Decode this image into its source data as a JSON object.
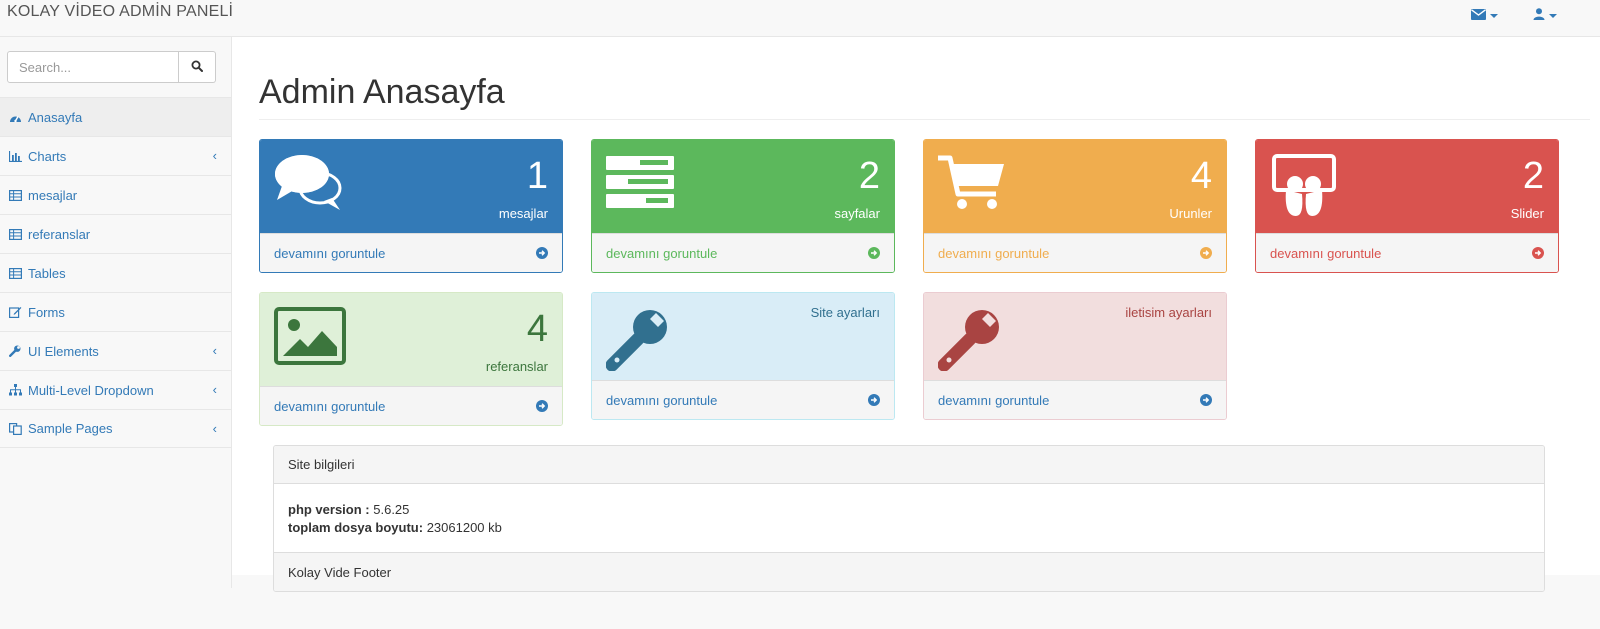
{
  "navbar": {
    "brand": "KOLAY VİDEO ADMİN PANELİ",
    "icons": [
      "envelope-icon",
      "user-icon"
    ]
  },
  "sidebar": {
    "search_placeholder": "Search...",
    "items": [
      {
        "label": "Anasayfa",
        "icon": "dashboard-icon",
        "has_submenu": false,
        "active": true
      },
      {
        "label": "Charts",
        "icon": "bar-chart-icon",
        "has_submenu": true,
        "active": false
      },
      {
        "label": "mesajlar",
        "icon": "table-icon",
        "has_submenu": false,
        "active": false
      },
      {
        "label": "referanslar",
        "icon": "table-icon",
        "has_submenu": false,
        "active": false
      },
      {
        "label": "Tables",
        "icon": "table-icon",
        "has_submenu": false,
        "active": false
      },
      {
        "label": "Forms",
        "icon": "edit-icon",
        "has_submenu": false,
        "active": false
      },
      {
        "label": "UI Elements",
        "icon": "wrench-icon",
        "has_submenu": true,
        "active": false
      },
      {
        "label": "Multi-Level Dropdown",
        "icon": "sitemap-icon",
        "has_submenu": true,
        "active": false
      },
      {
        "label": "Sample Pages",
        "icon": "files-icon",
        "has_submenu": true,
        "active": false
      }
    ]
  },
  "main": {
    "title": "Admin Anasayfa",
    "cards": [
      {
        "count": "1",
        "label": "mesajlar",
        "link": "devamını goruntule",
        "icon": "comments-icon",
        "theme": "#337ab7"
      },
      {
        "count": "2",
        "label": "sayfalar",
        "link": "devamını goruntule",
        "icon": "tasks-icon",
        "theme": "#5cb85c"
      },
      {
        "count": "4",
        "label": "Urunler",
        "link": "devamını goruntule",
        "icon": "shopping-cart-icon",
        "theme": "#f0ad4e"
      },
      {
        "count": "2",
        "label": "Slider",
        "link": "devamını goruntule",
        "icon": "slideshare-icon",
        "theme": "#d9534f"
      },
      {
        "count": "4",
        "label": "referanslar",
        "link": "devamını goruntule",
        "icon": "picture-icon",
        "theme": "#dff0d8"
      },
      {
        "count": "",
        "label": "Site ayarları",
        "link": "devamını goruntule",
        "icon": "wrench-icon",
        "theme": "#d9edf7"
      },
      {
        "count": "",
        "label": "iletisim ayarları",
        "link": "devamını goruntule",
        "icon": "wrench-icon",
        "theme": "#f2dede"
      }
    ],
    "site_info": {
      "heading": "Site bilgileri",
      "php_label": "php version :",
      "php_value": "5.6.25",
      "size_label": "toplam dosya boyutu:",
      "size_value": "23061200 kb",
      "footer": "Kolay Vide Footer"
    }
  }
}
